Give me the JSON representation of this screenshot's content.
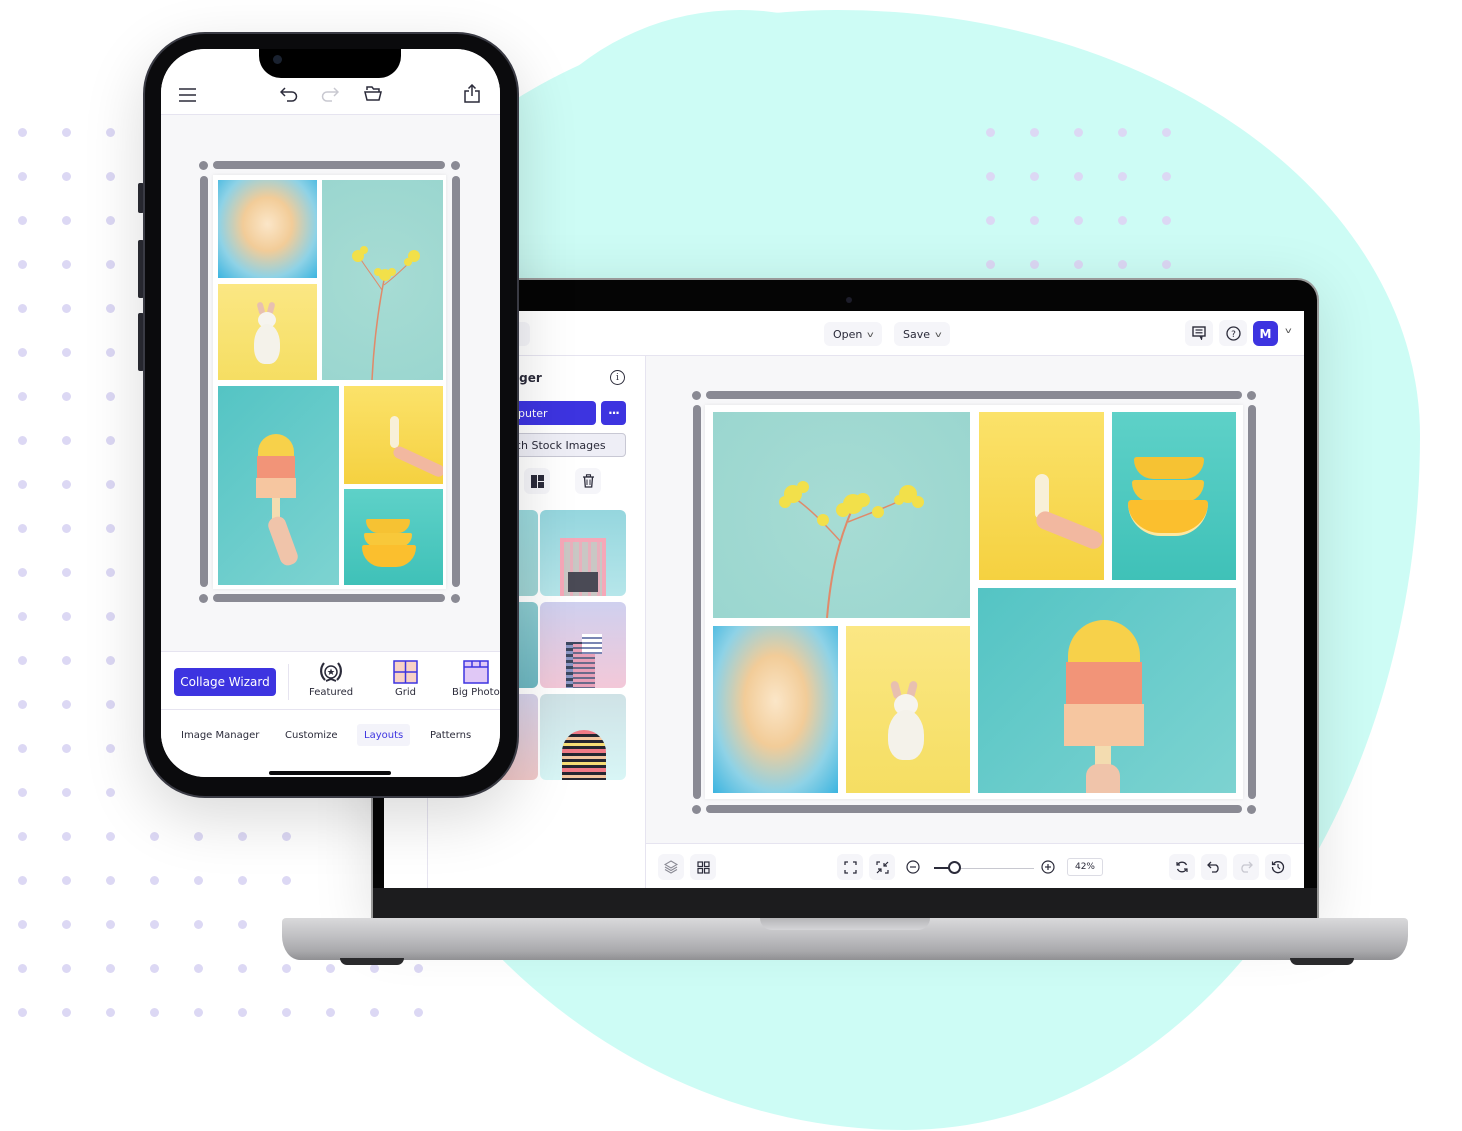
{
  "colors": {
    "accent": "#3d34e0",
    "background_blob": "#cdfcf5",
    "dot": "#dcd8f4",
    "frame_handle": "#8a8a94"
  },
  "phone": {
    "toolbar": {
      "menu_icon": "hamburger-menu-icon",
      "undo_icon": "undo-icon",
      "redo_icon": "redo-icon",
      "open_icon": "open-folder-icon",
      "share_icon": "share-icon"
    },
    "layout_bar": {
      "wizard_label": "Collage Wizard",
      "options": [
        {
          "label": "Featured",
          "icon": "laurel-star-icon"
        },
        {
          "label": "Grid",
          "icon": "grid-layout-icon"
        },
        {
          "label": "Big Photo",
          "icon": "big-photo-layout-icon"
        }
      ]
    },
    "tabs": [
      {
        "label": "Image Manager",
        "active": false
      },
      {
        "label": "Customize",
        "active": false
      },
      {
        "label": "Layouts",
        "active": true
      },
      {
        "label": "Patterns",
        "active": false
      }
    ],
    "collage_photos": [
      "cloud",
      "flower",
      "bunny",
      "popsicle",
      "banana",
      "orange"
    ]
  },
  "desktop": {
    "topbar": {
      "open_label": "Open",
      "save_label": "Save",
      "comments_icon": "comment-icon",
      "help_icon": "help-icon",
      "avatar_initial": "M"
    },
    "sidebar": {
      "title_fragment": "ager",
      "upload_label_fragment": "puter",
      "more_label": "···",
      "stock_label_fragment": "ch Stock Images",
      "tools": [
        "layout-icon",
        "trash-icon"
      ],
      "thumbnails": [
        "pink-building-columns",
        "purple-tower",
        "striped-round-tower"
      ]
    },
    "bottom_bar": {
      "layers_icon": "layers-icon",
      "grid_icon": "grid-icon",
      "fit_icon": "fullscreen-icon",
      "shrink_icon": "shrink-icon",
      "zoom_value": "42%",
      "zoom_fraction": 0.2,
      "refresh_icon": "refresh-icon",
      "undo_icon": "undo-icon",
      "redo_icon": "redo-icon",
      "history_icon": "history-icon"
    },
    "collage_photos": [
      "flower",
      "banana",
      "orange",
      "cloud",
      "bunny",
      "popsicle"
    ]
  }
}
